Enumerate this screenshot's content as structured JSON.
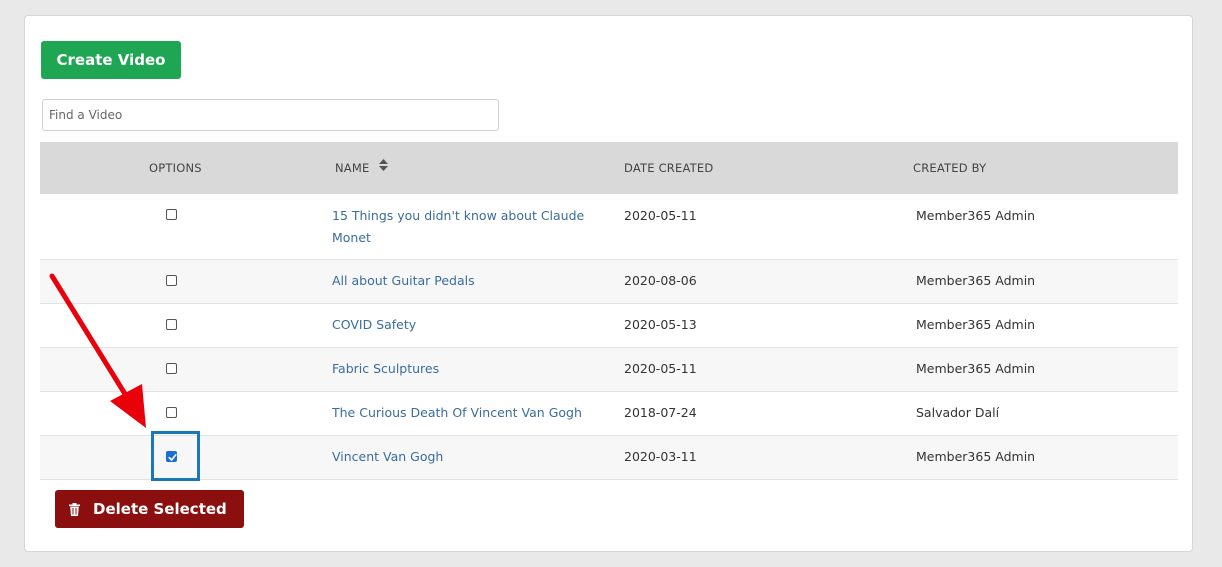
{
  "toolbar": {
    "create_label": "Create Video"
  },
  "search": {
    "placeholder": "Find a Video",
    "value": ""
  },
  "table": {
    "headers": {
      "options": "OPTIONS",
      "name": "NAME",
      "date_created": "DATE CREATED",
      "created_by": "CREATED BY"
    },
    "rows": [
      {
        "name_line1": "15 Things you didn't know about Claude",
        "name_line2": "Monet",
        "date": "2020-05-11",
        "author": "Member365 Admin",
        "checked": false
      },
      {
        "name_line1": "All about Guitar Pedals",
        "name_line2": "",
        "date": "2020-08-06",
        "author": "Member365 Admin",
        "checked": false
      },
      {
        "name_line1": "COVID Safety",
        "name_line2": "",
        "date": "2020-05-13",
        "author": "Member365 Admin",
        "checked": false
      },
      {
        "name_line1": "Fabric Sculptures",
        "name_line2": "",
        "date": "2020-05-11",
        "author": "Member365 Admin",
        "checked": false
      },
      {
        "name_line1": "The Curious Death Of Vincent Van Gogh",
        "name_line2": "",
        "date": "2018-07-24",
        "author": "Salvador Dalí",
        "checked": false
      },
      {
        "name_line1": "Vincent Van Gogh",
        "name_line2": "",
        "date": "2020-03-11",
        "author": "Member365 Admin",
        "checked": true
      }
    ]
  },
  "actions": {
    "delete_label": "Delete Selected"
  },
  "colors": {
    "create_button": "#1ea653",
    "delete_button": "#8b0f0f",
    "annotation_arrow": "#e8000b",
    "highlight_box": "#1a78b8",
    "link": "#3a6c9c"
  },
  "icons": {
    "sort": "sort-icon",
    "trash": "trash-icon",
    "check": "check-icon"
  }
}
